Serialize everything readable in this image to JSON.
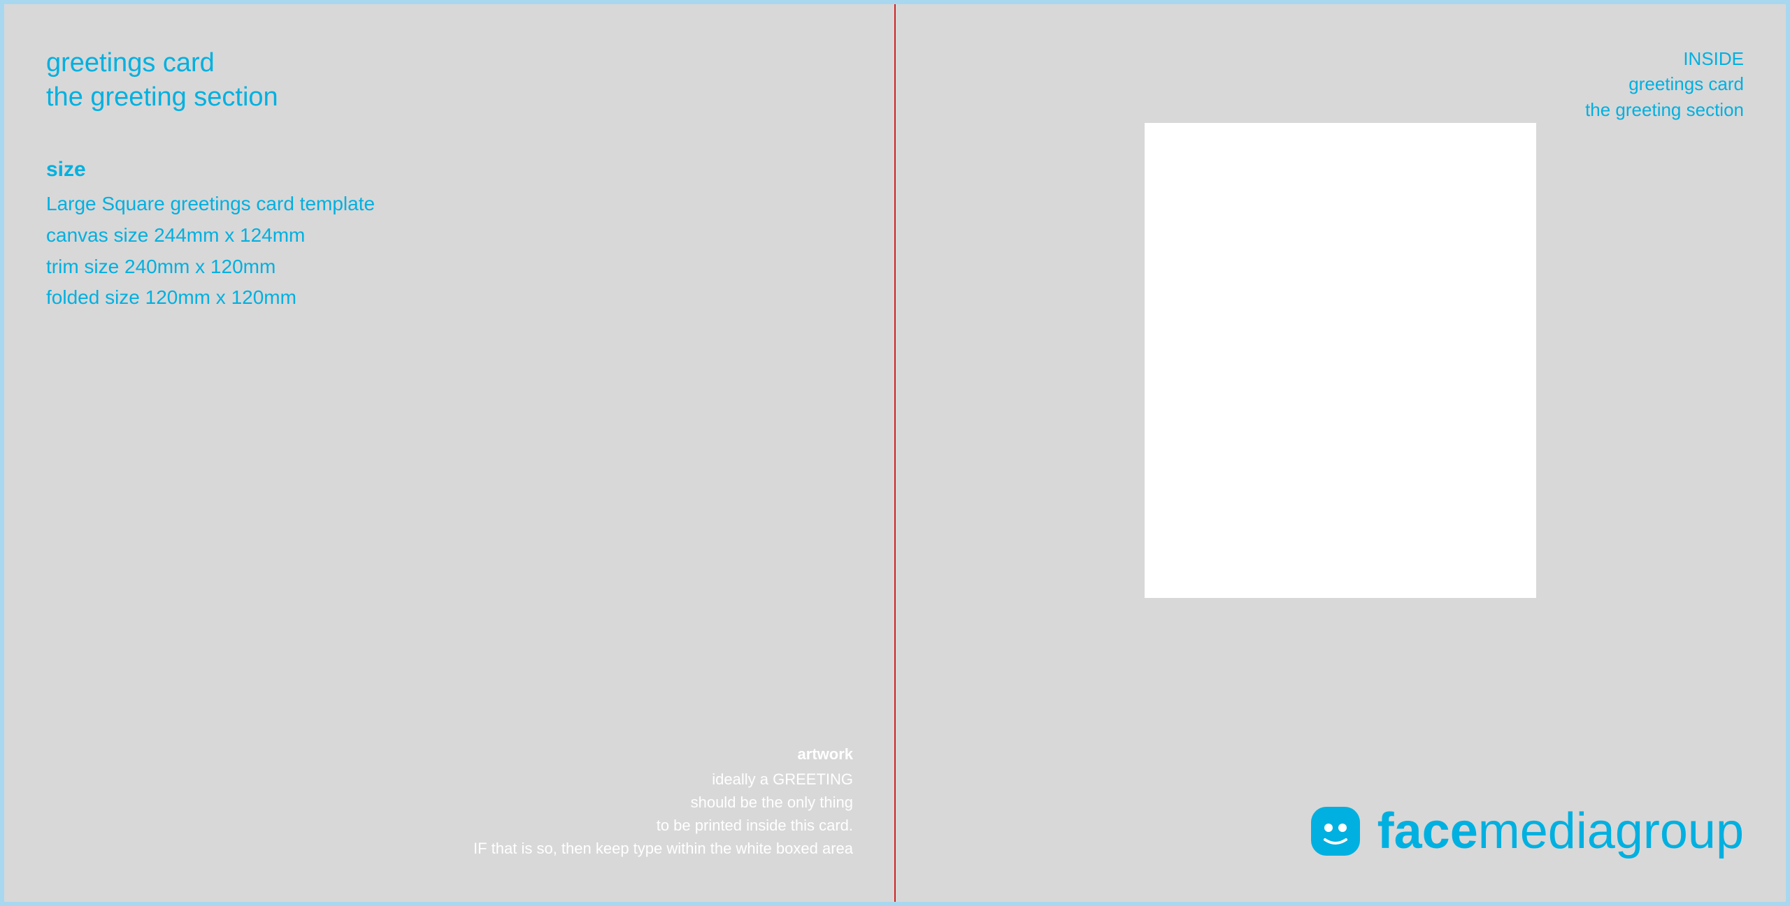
{
  "left": {
    "title_main": "greetings card",
    "title_sub": "the greeting section",
    "size_label": "size",
    "size_line1": "Large Square greetings card template",
    "size_line2": "canvas size 244mm x 124mm",
    "size_line3": "trim size 240mm x 120mm",
    "size_line4": "folded size 120mm x 120mm",
    "artwork_title": "artwork",
    "artwork_line1": "ideally a GREETING",
    "artwork_line2": "should be the only thing",
    "artwork_line3": "to be printed inside this card.",
    "artwork_line4": "IF that is so, then keep type within the white boxed area"
  },
  "right": {
    "inside_word": "INSIDE",
    "inside_card": "greetings card",
    "inside_section": "the greeting section",
    "logo_text_face": "face",
    "logo_text_media": "mediagroup"
  },
  "colors": {
    "cyan": "#00b0e0",
    "white": "#ffffff",
    "red_line": "#cc2222",
    "bg": "#d8d8d8",
    "border": "#a8d8f0"
  }
}
